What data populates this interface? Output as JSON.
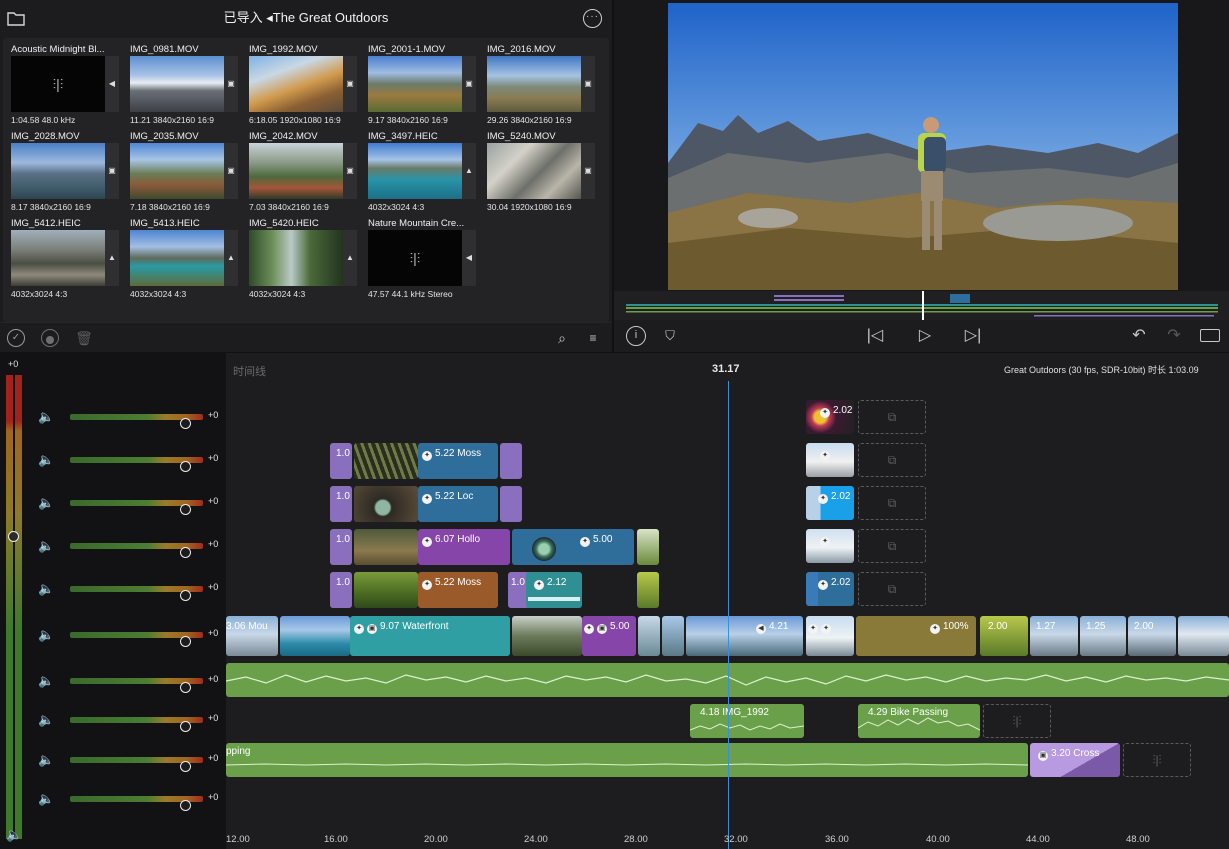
{
  "browser": {
    "title": "已导入 ◂The Great Outdoors",
    "icons": [
      "folder-icon",
      "ellipsis-circle-icon"
    ],
    "items": [
      {
        "name": "Acoustic Midnight Bl...",
        "meta": "1:04.58  48.0 kHz",
        "type": "audio"
      },
      {
        "name": "IMG_0981.MOV",
        "meta": "11.21  3840x2160  16:9",
        "type": "video"
      },
      {
        "name": "IMG_1992.MOV",
        "meta": "6:18.05  1920x1080  16:9",
        "type": "video"
      },
      {
        "name": "IMG_2001-1.MOV",
        "meta": "9.17  3840x2160  16:9",
        "type": "video"
      },
      {
        "name": "IMG_2016.MOV",
        "meta": "29.26  3840x2160  16:9",
        "type": "video"
      },
      {
        "name": "IMG_2028.MOV",
        "meta": "8.17  3840x2160  16:9",
        "type": "video"
      },
      {
        "name": "IMG_2035.MOV",
        "meta": "7.18  3840x2160  16:9",
        "type": "video"
      },
      {
        "name": "IMG_2042.MOV",
        "meta": "7.03  3840x2160  16:9",
        "type": "video"
      },
      {
        "name": "IMG_3497.HEIC",
        "meta": "4032x3024  4:3",
        "type": "photo"
      },
      {
        "name": "IMG_5240.MOV",
        "meta": "30.04  1920x1080  16:9",
        "type": "video"
      },
      {
        "name": "IMG_5412.HEIC",
        "meta": "4032x3024  4:3",
        "type": "photo"
      },
      {
        "name": "IMG_5413.HEIC",
        "meta": "4032x3024  4:3",
        "type": "photo"
      },
      {
        "name": "IMG_5420.HEIC",
        "meta": "4032x3024  4:3",
        "type": "photo"
      },
      {
        "name": "Nature Mountain Cre...",
        "meta": "47.57  44.1 kHz  Stereo",
        "type": "audio"
      }
    ],
    "toolbar": [
      "checkmark-circle-icon",
      "record-icon",
      "trash-icon",
      "search-icon",
      "sort-icon"
    ]
  },
  "viewer": {
    "controls": [
      "info-icon",
      "marker-icon",
      "skip-back-icon",
      "play-icon",
      "skip-forward-icon",
      "undo-icon",
      "redo-icon",
      "fullscreen-icon"
    ]
  },
  "timeline": {
    "label": "时间线",
    "playhead_time": "31.17",
    "project_info": "Great Outdoors (30 fps, SDR-10bit) 时长 1:03.09",
    "master_level": "+0",
    "gains": [
      "+0",
      "+0",
      "+0",
      "+0",
      "+0",
      "+0",
      "+0",
      "+0",
      "+0",
      "+0"
    ],
    "ruler": [
      "12.00",
      "16.00",
      "20.00",
      "24.00",
      "28.00",
      "32.00",
      "36.00",
      "40.00",
      "44.00",
      "48.00"
    ],
    "clips": {
      "moss1": "5.22  Moss",
      "loc": "5.22  Loc",
      "hollow": "6.07  Hollo",
      "moss2": "5.22  Moss",
      "five": "5.00",
      "two12": "2.12",
      "mou": "3.06  Mou",
      "waterfront": "9.07  Waterfront",
      "five_b": "5.00",
      "four21": "4.21",
      "pct": "100%",
      "two00": "2.00",
      "one27": "1.27",
      "one25": "1.25",
      "two00b": "2.00",
      "img1992": "4.18  IMG_1992",
      "bike": "4.29  Bike Passing",
      "cross": "3.20  Cross",
      "pping": "pping",
      "r1": "2.02",
      "r3": "2.02",
      "r5": "2.02",
      "one0": "1.0"
    },
    "colors": {
      "purple": "#8a6fbf",
      "teal": "#2f8f93",
      "blue": "#2f6d9a",
      "audio": "#6aa04a"
    }
  }
}
